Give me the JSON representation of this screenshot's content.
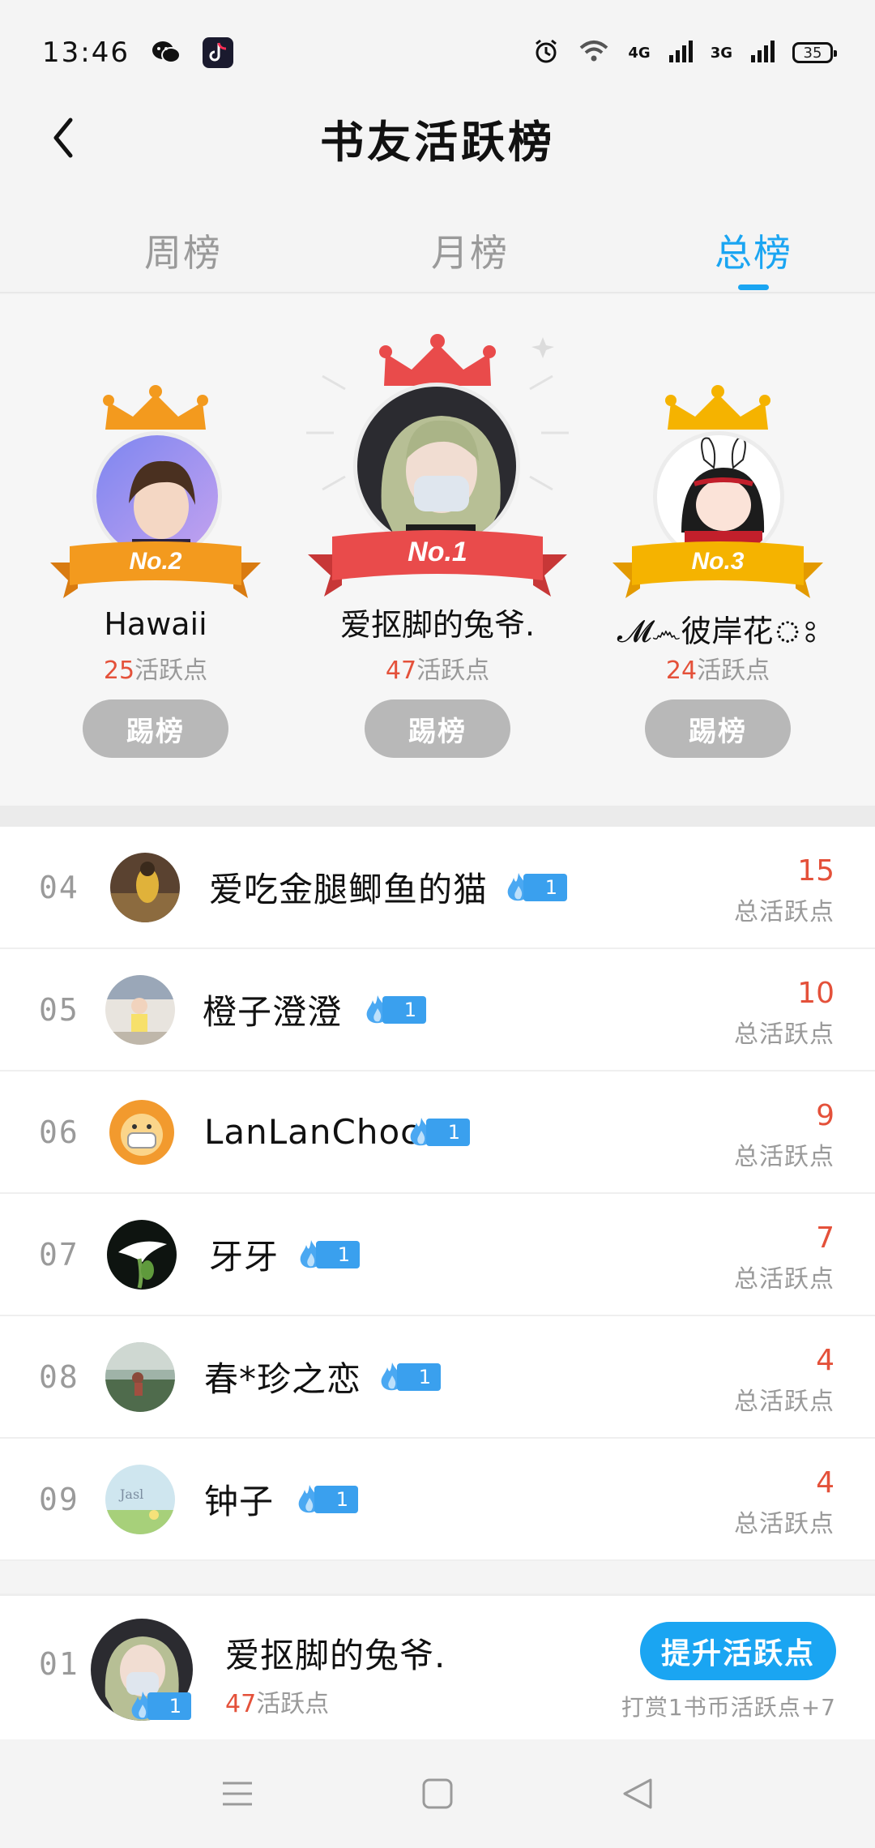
{
  "status_bar": {
    "time": "13:46",
    "net1": "4G",
    "net2": "3G",
    "battery": "35"
  },
  "header": {
    "title": "书友活跃榜"
  },
  "tabs": [
    {
      "label": "周榜",
      "active": false
    },
    {
      "label": "月榜",
      "active": false
    },
    {
      "label": "总榜",
      "active": true
    }
  ],
  "podium": {
    "second": {
      "rank": "No.2",
      "name": "Hawaii",
      "score": "25",
      "score_unit": "活跃点",
      "button": "踢榜"
    },
    "first": {
      "rank": "No.1",
      "name": "爱抠脚的兔爷.",
      "score": "47",
      "score_unit": "活跃点",
      "button": "踢榜"
    },
    "third": {
      "rank": "No.3",
      "name": "𝓜෴彼岸花ঃ",
      "score": "24",
      "score_unit": "活跃点",
      "button": "踢榜"
    }
  },
  "list": [
    {
      "rank": "04",
      "name": "爱吃金腿鲫鱼的猫",
      "badge": "1",
      "score": "15",
      "score_label": "总活跃点"
    },
    {
      "rank": "05",
      "name": "橙子澄澄",
      "badge": "1",
      "score": "10",
      "score_label": "总活跃点"
    },
    {
      "rank": "06",
      "name": "LanLanChoco",
      "badge": "1",
      "score": "9",
      "score_label": "总活跃点"
    },
    {
      "rank": "07",
      "name": "牙牙",
      "badge": "1",
      "score": "7",
      "score_label": "总活跃点"
    },
    {
      "rank": "08",
      "name": "春*珍之恋",
      "badge": "1",
      "score": "4",
      "score_label": "总活跃点"
    },
    {
      "rank": "09",
      "name": "钟子",
      "badge": "1",
      "score": "4",
      "score_label": "总活跃点"
    }
  ],
  "my_rank": {
    "rank": "01",
    "name": "爱抠脚的兔爷.",
    "badge": "1",
    "score": "47",
    "score_unit": "活跃点",
    "button": "提升活跃点",
    "hint": "打赏1书币活跃点+7"
  },
  "colors": {
    "accent": "#1aa5f2",
    "score_red": "#e4513a",
    "gold_second": "#f39a1e",
    "red_first": "#e94b4b",
    "gold_third": "#f5b300"
  }
}
